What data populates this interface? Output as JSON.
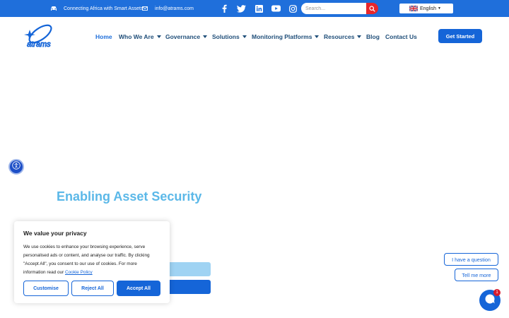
{
  "topbar": {
    "tagline": "Connecting Africa with Smart Assets",
    "email": "info@atrams.com",
    "tagline_icon": "car-icon",
    "email_icon": "envelope-icon",
    "social": [
      "facebook-icon",
      "twitter-icon",
      "linkedin-icon",
      "youtube-icon",
      "instagram-icon"
    ],
    "search_placeholder": "Search...",
    "language": "English",
    "bg_color": "#1f6fdb",
    "search_button_color": "#e8262b"
  },
  "nav": {
    "items": [
      {
        "label": "Home",
        "dropdown": false,
        "active": true
      },
      {
        "label": "Who We Are",
        "dropdown": true
      },
      {
        "label": "Governance",
        "dropdown": true
      },
      {
        "label": "Solutions",
        "dropdown": true
      },
      {
        "label": "Monitoring Platforms",
        "dropdown": true
      },
      {
        "label": "Resources",
        "dropdown": true
      },
      {
        "label": "Blog",
        "dropdown": false
      },
      {
        "label": "Contact Us",
        "dropdown": false
      }
    ],
    "cta": "Get Started",
    "logo_text": "atrams"
  },
  "hero": {
    "title": "Enabling Asset Security",
    "title_color": "#5bb8e8"
  },
  "cookie": {
    "title": "We value your privacy",
    "text": "We use cookies to enhance your browsing experience, serve personalised ads or content, and analyse our traffic. By clicking \"Accept All\", you consent to our use of cookies. For more information read our ",
    "link": "Cookie Policy",
    "customise": "Customise",
    "reject": "Reject All",
    "accept": "Accept All"
  },
  "chat": {
    "question": "I have a question",
    "more": "Tell me more",
    "badge": "1"
  },
  "accent": "#1565d8"
}
